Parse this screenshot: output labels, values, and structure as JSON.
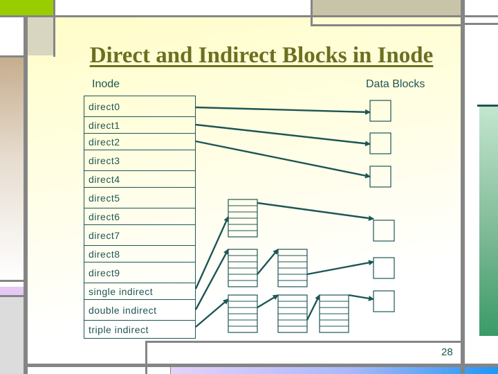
{
  "slide": {
    "title": "Direct and Indirect Blocks in Inode",
    "inode_header": "Inode",
    "data_blocks_header": "Data Blocks",
    "page_number": "28"
  },
  "colors": {
    "title": "#6b7020",
    "diagram_stroke": "#1d5555",
    "frame": "#858585",
    "accent_green": "#9acd00",
    "accent_tan": "#c8c4a8"
  },
  "inode_fields": [
    {
      "label": "direct0"
    },
    {
      "label": "direct1"
    },
    {
      "label": "direct2"
    },
    {
      "label": "direct3"
    },
    {
      "label": "direct4"
    },
    {
      "label": "direct5"
    },
    {
      "label": "direct6"
    },
    {
      "label": "direct7"
    },
    {
      "label": "direct8"
    },
    {
      "label": "direct9"
    },
    {
      "label": "single indirect"
    },
    {
      "label": "double indirect"
    },
    {
      "label": "triple indirect"
    }
  ],
  "diagram": {
    "data_blocks": 6,
    "index_blocks": [
      {
        "id": "single-L1",
        "entries": 6
      },
      {
        "id": "double-L1",
        "entries": 6
      },
      {
        "id": "double-L2",
        "entries": 6
      },
      {
        "id": "triple-L1",
        "entries": 6
      },
      {
        "id": "triple-L2",
        "entries": 6
      },
      {
        "id": "triple-L3",
        "entries": 6
      }
    ],
    "pointers": [
      {
        "from": "direct0",
        "to": "data-block-1"
      },
      {
        "from": "direct1",
        "to": "data-block-2"
      },
      {
        "from": "direct2",
        "to": "data-block-3"
      },
      {
        "from": "single indirect",
        "to": "single-L1"
      },
      {
        "from": "single-L1",
        "to": "data-block-4"
      },
      {
        "from": "double indirect",
        "to": "double-L1"
      },
      {
        "from": "double-L1",
        "to": "double-L2"
      },
      {
        "from": "double-L2",
        "to": "data-block-5"
      },
      {
        "from": "triple indirect",
        "to": "triple-L1"
      },
      {
        "from": "triple-L1",
        "to": "triple-L2"
      },
      {
        "from": "triple-L2",
        "to": "triple-L3"
      },
      {
        "from": "triple-L3",
        "to": "data-block-6"
      }
    ]
  }
}
